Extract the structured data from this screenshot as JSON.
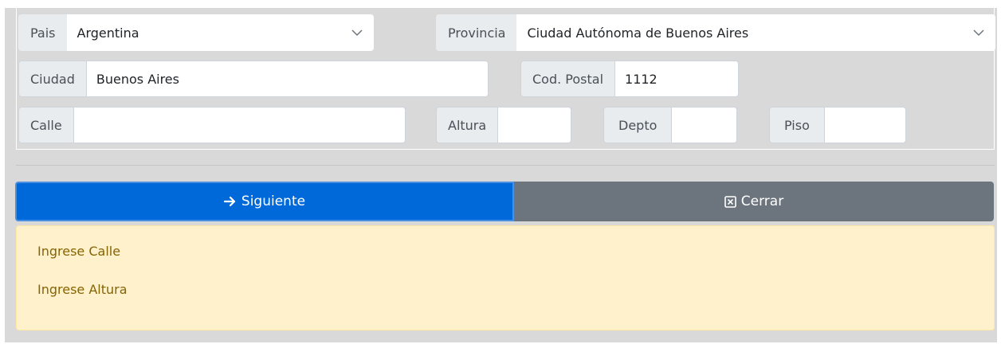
{
  "address": {
    "pais": {
      "label": "Pais",
      "value": "Argentina"
    },
    "provincia": {
      "label": "Provincia",
      "value": "Ciudad Autónoma de Buenos Aires"
    },
    "ciudad": {
      "label": "Ciudad",
      "value": "Buenos Aires"
    },
    "cod_postal": {
      "label": "Cod. Postal",
      "value": "1112"
    },
    "calle": {
      "label": "Calle",
      "value": ""
    },
    "altura": {
      "label": "Altura",
      "value": ""
    },
    "depto": {
      "label": "Depto",
      "value": ""
    },
    "piso": {
      "label": "Piso",
      "value": ""
    }
  },
  "actions": {
    "next_label": "Siguiente",
    "next_icon": "arrow-right-icon",
    "close_label": "Cerrar",
    "close_icon": "close-square-icon"
  },
  "alert": {
    "messages": [
      "Ingrese Calle",
      "Ingrese Altura"
    ]
  },
  "colors": {
    "primary": "#0069d9",
    "secondary": "#6c757d",
    "warning_bg": "#fff1cc",
    "warning_text": "#856404"
  }
}
